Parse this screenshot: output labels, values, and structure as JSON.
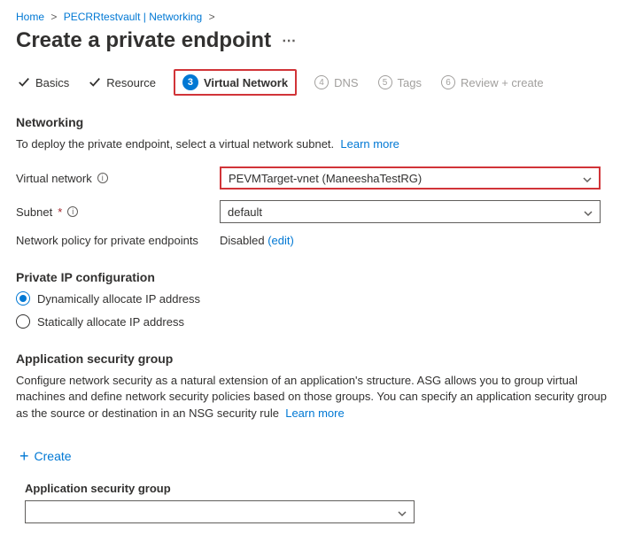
{
  "breadcrumb": {
    "home": "Home",
    "vault": "PECRRtestvault | Networking"
  },
  "page_title": "Create a private endpoint",
  "tabs": {
    "basics": "Basics",
    "resource": "Resource",
    "step3_num": "3",
    "virtual_network": "Virtual Network",
    "step4_num": "4",
    "dns": "DNS",
    "step5_num": "5",
    "tags": "Tags",
    "step6_num": "6",
    "review": "Review + create"
  },
  "networking": {
    "title": "Networking",
    "desc": "To deploy the private endpoint, select a virtual network subnet.",
    "learn_more": "Learn more",
    "vnet_label": "Virtual network",
    "vnet_value": "PEVMTarget-vnet (ManeeshaTestRG)",
    "subnet_label": "Subnet",
    "subnet_value": "default",
    "policy_label": "Network policy for private endpoints",
    "policy_value": "Disabled",
    "policy_edit": "(edit)"
  },
  "ip_config": {
    "title": "Private IP configuration",
    "opt_dynamic": "Dynamically allocate IP address",
    "opt_static": "Statically allocate IP address"
  },
  "asg": {
    "title": "Application security group",
    "desc": "Configure network security as a natural extension of an application's structure. ASG allows you to group virtual machines and define network security policies based on those groups. You can specify an application security group as the source or destination in an NSG security rule",
    "learn_more": "Learn more",
    "create": "Create",
    "dropdown_label": "Application security group"
  }
}
